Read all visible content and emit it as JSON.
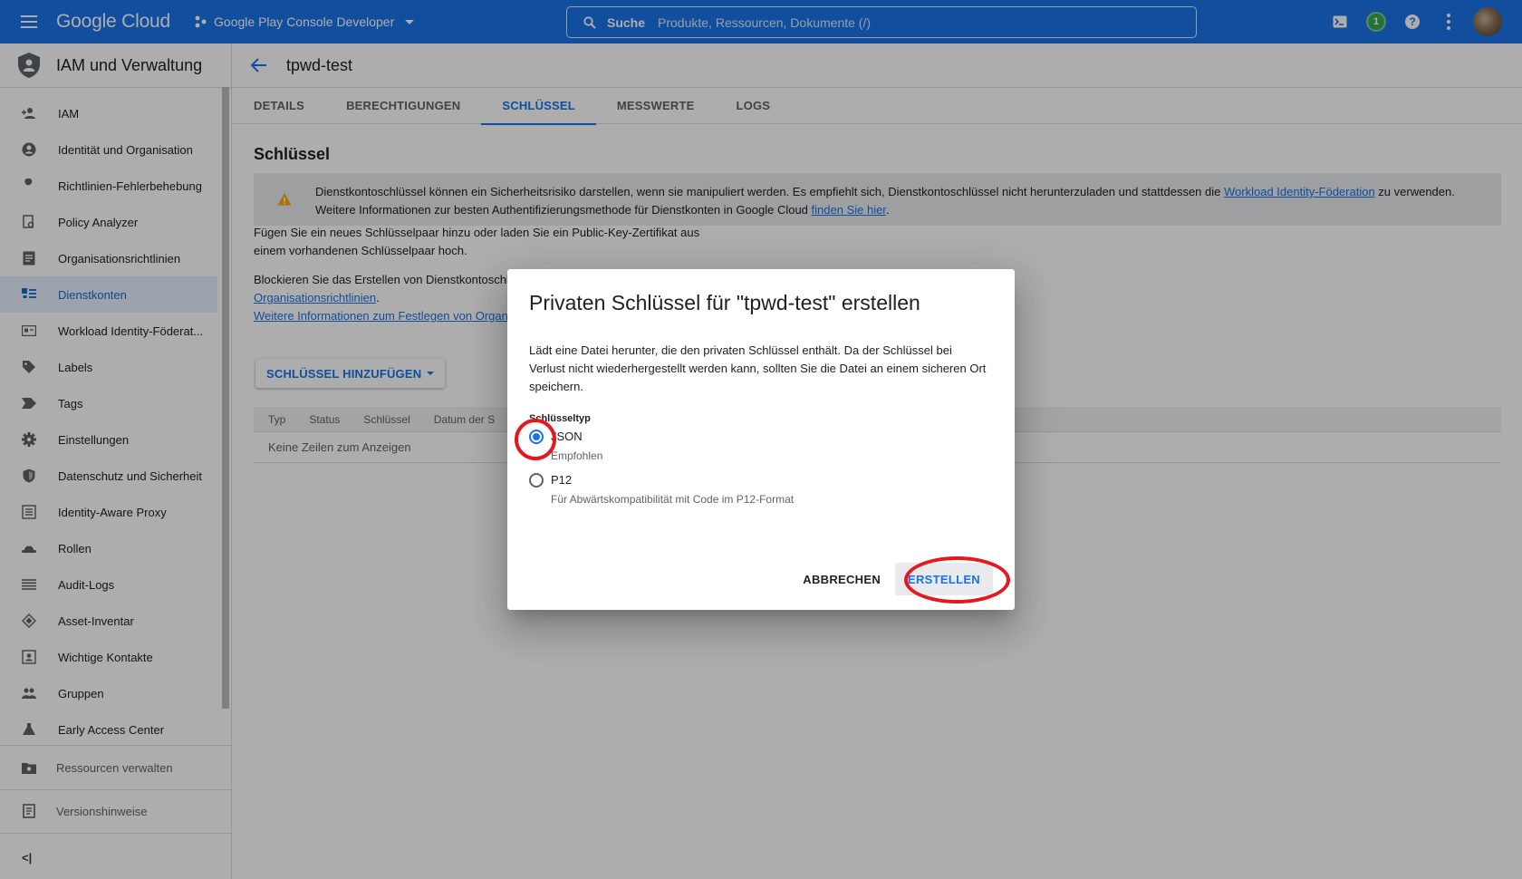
{
  "topbar": {
    "logo": "Google Cloud",
    "project": "Google Play Console Developer",
    "search_label": "Suche",
    "search_placeholder": "Produkte, Ressourcen, Dokumente (/)",
    "notification_count": "1",
    "help_glyph": "?"
  },
  "sidebar": {
    "title": "IAM und Verwaltung",
    "items": [
      {
        "label": "IAM",
        "icon": "person-add-icon"
      },
      {
        "label": "Identität und Organisation",
        "icon": "account-circle-icon"
      },
      {
        "label": "Richtlinien-Fehlerbehebung",
        "icon": "wrench-icon"
      },
      {
        "label": "Policy Analyzer",
        "icon": "document-search-icon"
      },
      {
        "label": "Organisationsrichtlinien",
        "icon": "list-document-icon"
      },
      {
        "label": "Dienstkonten",
        "icon": "service-account-icon"
      },
      {
        "label": "Workload Identity-Föderat...",
        "icon": "id-card-icon"
      },
      {
        "label": "Labels",
        "icon": "label-icon"
      },
      {
        "label": "Tags",
        "icon": "tag-icon"
      },
      {
        "label": "Einstellungen",
        "icon": "gear-icon"
      },
      {
        "label": "Datenschutz und Sicherheit",
        "icon": "shield-icon"
      },
      {
        "label": "Identity-Aware Proxy",
        "icon": "proxy-icon"
      },
      {
        "label": "Rollen",
        "icon": "hat-icon"
      },
      {
        "label": "Audit-Logs",
        "icon": "lines-icon"
      },
      {
        "label": "Asset-Inventar",
        "icon": "diamond-icon"
      },
      {
        "label": "Wichtige Kontakte",
        "icon": "contact-icon"
      },
      {
        "label": "Gruppen",
        "icon": "group-icon"
      },
      {
        "label": "Early Access Center",
        "icon": "flask-icon"
      }
    ],
    "active_index": 5,
    "manage_resources": "Ressourcen verwalten",
    "release_notes": "Versionshinweise",
    "collapse_glyph": "<|"
  },
  "main": {
    "page_title": "tpwd-test",
    "tabs": [
      "DETAILS",
      "BERECHTIGUNGEN",
      "SCHLÜSSEL",
      "MESSWERTE",
      "LOGS"
    ],
    "active_tab": 2,
    "section_title": "Schlüssel",
    "warning_line1": "Dienstkontoschlüssel können ein Sicherheitsrisiko darstellen, wenn sie manipuliert werden. Es empfiehlt sich, Dienstkontoschlüssel nicht herunterzuladen und stattdessen die ",
    "warning_link1": "Workload Identity-Föderation",
    "warning_line1_end": " zu verwenden.",
    "warning_line2": "Weitere Informationen zur besten Authentifizierungsmethode für Dienstkonten in Google Cloud ",
    "warning_link2": "finden Sie hier",
    "warning_line2_end": ".",
    "add_info_1": "Fügen Sie ein neues Schlüsselpaar hinzu oder laden Sie ein Public-Key-Zertifikat aus",
    "add_info_2": "einem vorhandenen Schlüsselpaar hoch.",
    "block_info": "Blockieren Sie das Erstellen von Dienstkontoschl",
    "block_link1": "Organisationsrichtlinien",
    "block_link1_end": ".",
    "block_link2": "Weitere Informationen zum Festlegen von Organi",
    "add_key_button": "SCHLÜSSEL HINZUFÜGEN",
    "table_headers": [
      "Typ",
      "Status",
      "Schlüssel",
      "Datum der S"
    ],
    "table_empty": "Keine Zeilen zum Anzeigen"
  },
  "dialog": {
    "title": "Privaten Schlüssel für \"tpwd-test\" erstellen",
    "body": "Lädt eine Datei herunter, die den privaten Schlüssel enthält. Da der Schlüssel bei Verlust nicht wiederhergestellt werden kann, sollten Sie die Datei an einem sicheren Ort speichern.",
    "key_type_label": "Schlüsseltyp",
    "options": [
      {
        "label": "JSON",
        "sub": "Empfohlen",
        "checked": true
      },
      {
        "label": "P12",
        "sub": "Für Abwärtskompatibilität mit Code im P12-Format",
        "checked": false
      }
    ],
    "cancel_label": "ABBRECHEN",
    "create_label": "ERSTELLEN"
  },
  "colors": {
    "brand": "#1a73e8",
    "annotation": "#e8161e",
    "warning": "#f9ab00"
  }
}
